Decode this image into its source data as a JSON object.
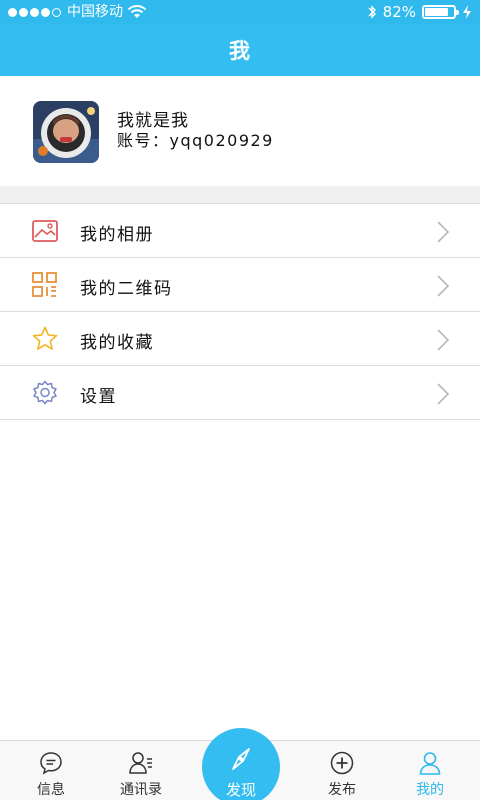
{
  "status_bar": {
    "signal_dots": [
      true,
      true,
      true,
      true,
      false
    ],
    "carrier": "中国移动",
    "battery_text": "82%",
    "battery_level": 0.82
  },
  "nav": {
    "title": "我"
  },
  "profile": {
    "name": "我就是我",
    "account": "账号：yqq020929"
  },
  "menu": {
    "items": [
      {
        "label": "我的相册",
        "icon": "album-icon",
        "color": "#e05a5a"
      },
      {
        "label": "我的二维码",
        "icon": "qrcode-icon",
        "color": "#e8913a"
      },
      {
        "label": "我的收藏",
        "icon": "star-icon",
        "color": "#f2b523"
      },
      {
        "label": "设置",
        "icon": "gear-icon",
        "color": "#7a86c8"
      }
    ]
  },
  "tabbar": {
    "tabs": [
      {
        "label": "信息",
        "icon": "message-icon"
      },
      {
        "label": "通讯录",
        "icon": "contacts-icon"
      },
      {
        "label": "发现",
        "icon": "compass-icon"
      },
      {
        "label": "发布",
        "icon": "plus-circle-icon"
      },
      {
        "label": "我的",
        "icon": "person-icon",
        "active": true
      }
    ]
  },
  "colors": {
    "accent": "#34bdf0",
    "active_tab": "#2fb9ec"
  }
}
